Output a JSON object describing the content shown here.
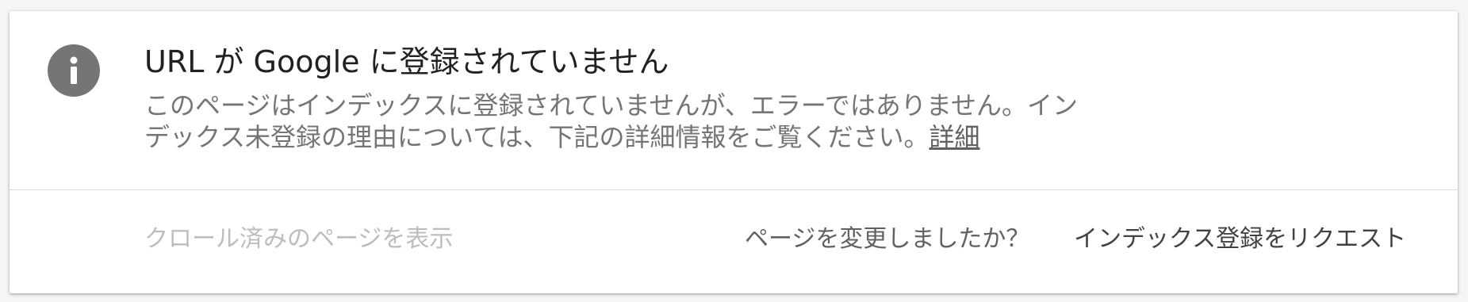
{
  "status_card": {
    "icon": "info-icon",
    "title": "URL が Google に登録されていません",
    "description": "このページはインデックスに登録されていませんが、エラーではありません。インデックス未登録の理由については、下記の詳細情報をご覧ください。",
    "detail_link": "詳細"
  },
  "footer": {
    "view_crawled_label": "クロール済みのページを表示",
    "changed_question": "ページを変更しましたか？",
    "request_indexing_label": "インデックス登録をリクエスト"
  },
  "colors": {
    "icon_bg": "#757575",
    "title_text": "#212121",
    "desc_text": "#757575",
    "disabled_text": "#bdbdbd"
  }
}
